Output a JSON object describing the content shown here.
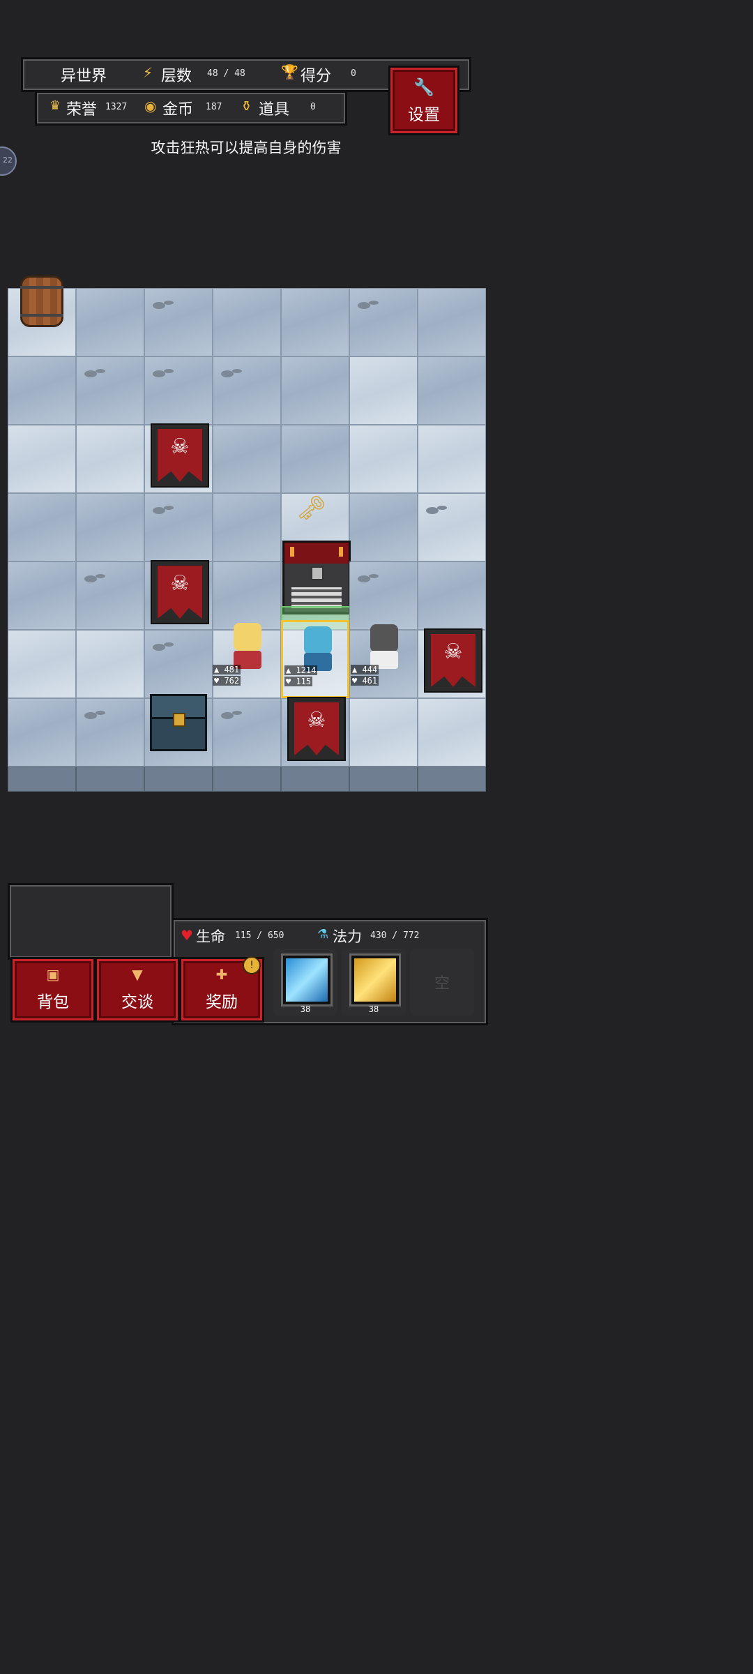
{
  "hud": {
    "world": "异世界",
    "floor_label": "层数",
    "floor_value": "48 / 48",
    "score_label": "得分",
    "score_value": "0",
    "honor_label": "荣誉",
    "honor_value": "1327",
    "gold_label": "金币",
    "gold_value": "187",
    "items_label": "道具",
    "items_value": "0",
    "settings_label": "设置",
    "side_badge": "22"
  },
  "tip": "攻击狂热可以提高自身的伤害",
  "units": {
    "ally_left": {
      "atk": "481",
      "hp": "762"
    },
    "hero": {
      "atk": "1214",
      "hp": "115"
    },
    "ally_right": {
      "atk": "444",
      "hp": "461"
    }
  },
  "status": {
    "life_label": "生命",
    "life_value": "115 / 650",
    "mana_label": "法力",
    "mana_value": "430 / 772"
  },
  "buttons": {
    "bag": "背包",
    "talk": "交谈",
    "reward": "奖励",
    "reward_badge": "!"
  },
  "skills": [
    {
      "name": "lightning-skill",
      "count": "38"
    },
    {
      "name": "holy-card-skill",
      "count": "38"
    },
    {
      "name": "empty-slot",
      "label": "空"
    }
  ],
  "colors": {
    "accent_red": "#8a0e14",
    "select_yellow": "#f2c32f",
    "background": "#222224"
  }
}
